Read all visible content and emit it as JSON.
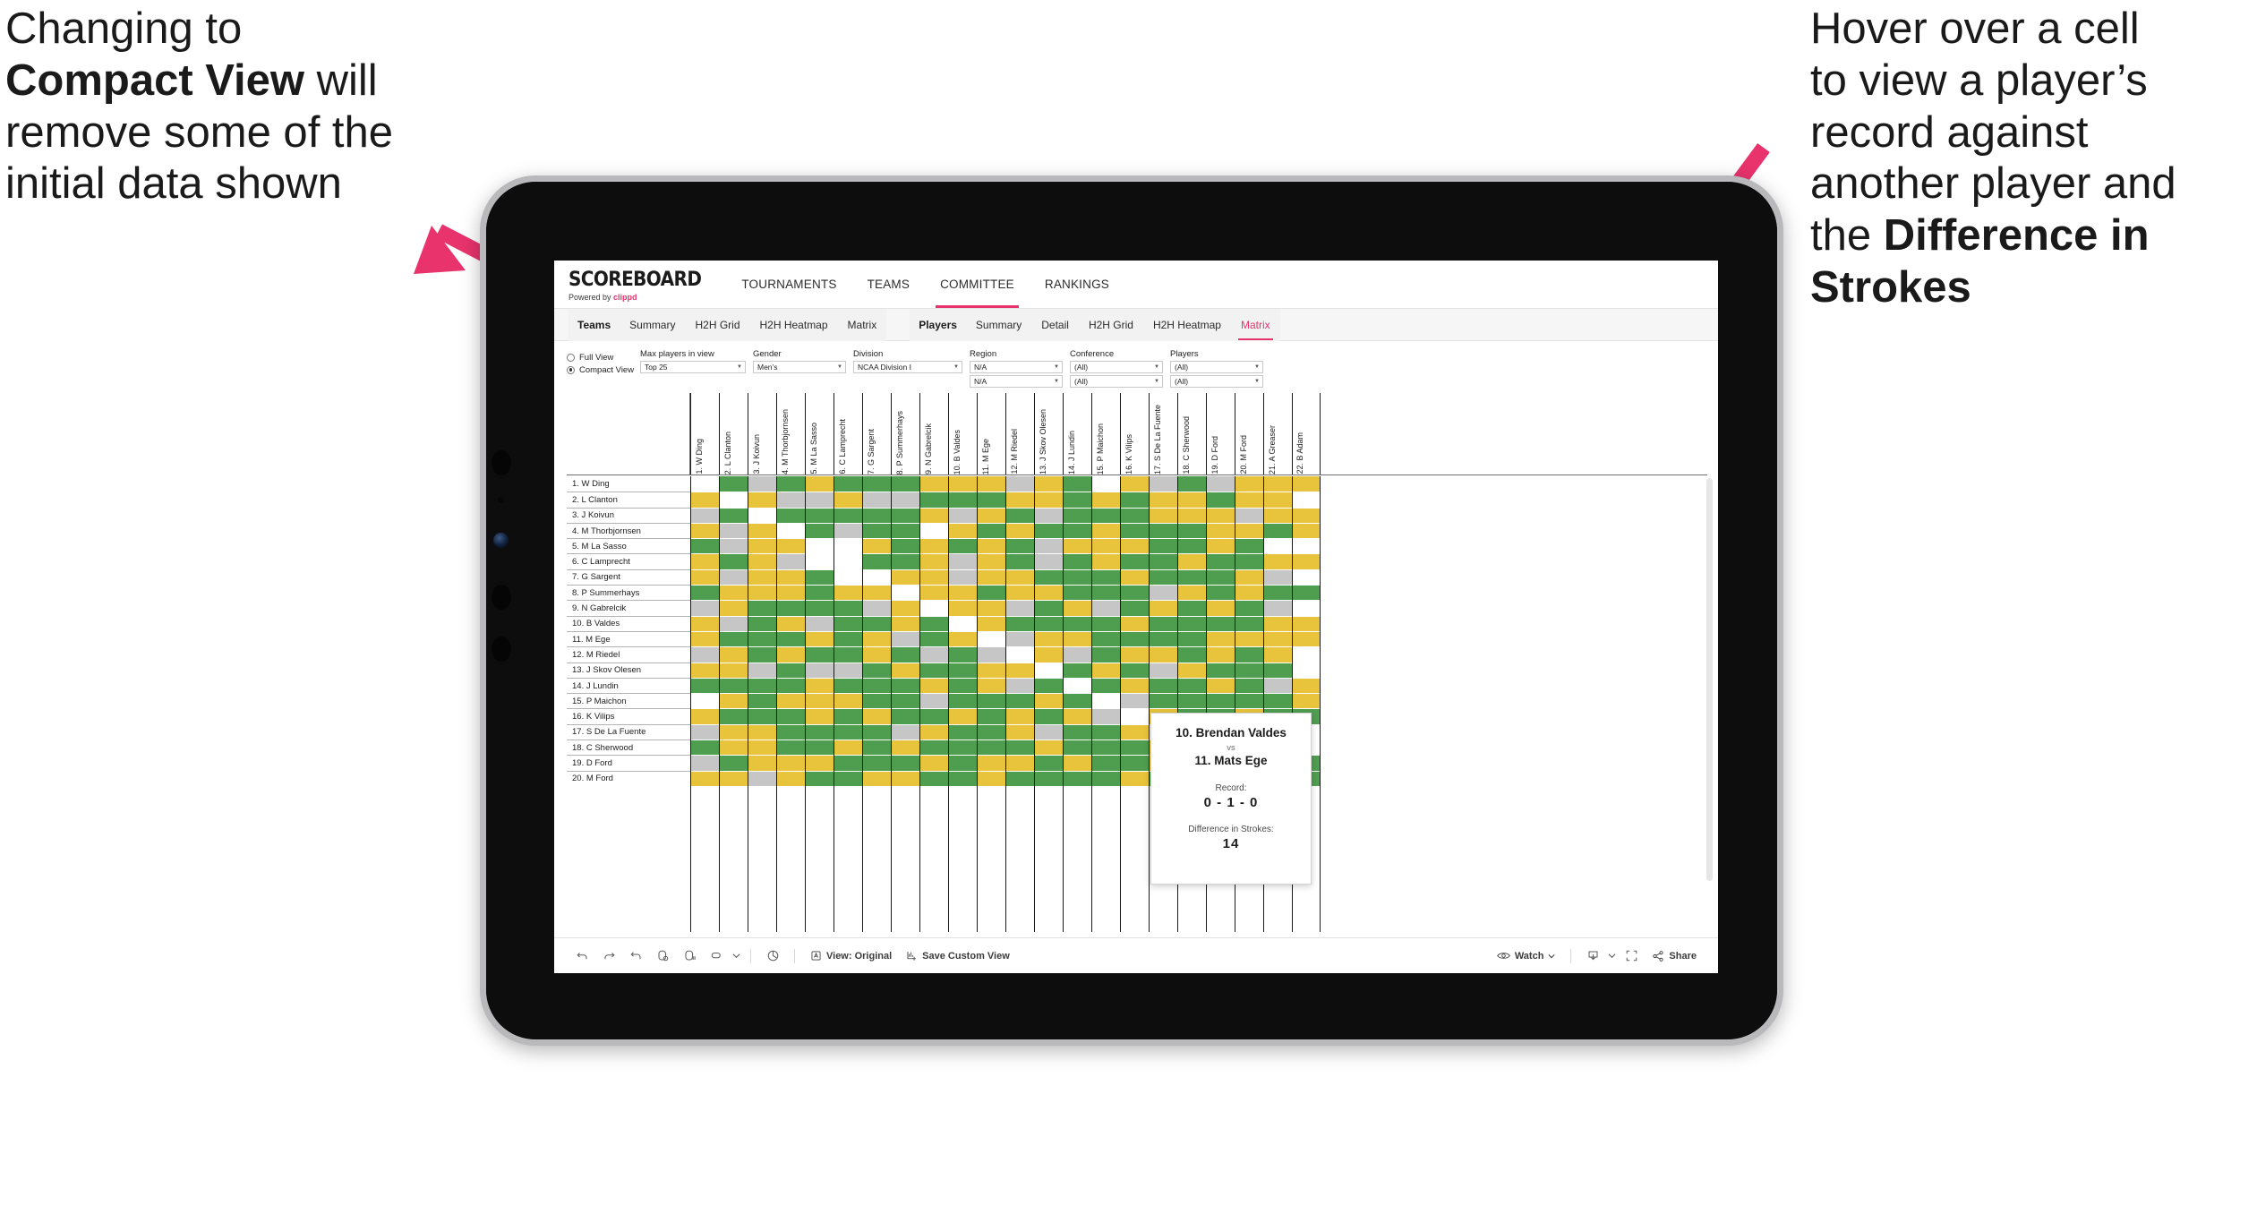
{
  "annotations": {
    "left": {
      "line1": "Changing to",
      "bold": "Compact View",
      "line2": " will",
      "line3": "remove some of the",
      "line4": "initial data shown"
    },
    "right": {
      "line1": "Hover over a cell",
      "line2": "to view a player’s",
      "line3": "record against",
      "line4": "another player and",
      "line5": "the ",
      "bold": "Difference in",
      "bold2": "Strokes"
    },
    "arrow_color": "#e8336d"
  },
  "brand": {
    "title": "SCOREBOARD",
    "powered_prefix": "Powered by ",
    "powered_name": "clippd",
    "accent": "#e8336d"
  },
  "topnav": {
    "items": [
      {
        "label": "TOURNAMENTS",
        "active": false
      },
      {
        "label": "TEAMS",
        "active": false
      },
      {
        "label": "COMMITTEE",
        "active": true
      },
      {
        "label": "RANKINGS",
        "active": false
      }
    ]
  },
  "subnav": {
    "group1": {
      "head": "Teams",
      "items": [
        "Summary",
        "H2H Grid",
        "H2H Heatmap",
        "Matrix"
      ],
      "active": null
    },
    "group2": {
      "head": "Players",
      "items": [
        "Summary",
        "Detail",
        "H2H Grid",
        "H2H Heatmap",
        "Matrix"
      ],
      "active": "Matrix"
    }
  },
  "filters": {
    "view_mode": {
      "full_label": "Full View",
      "compact_label": "Compact View",
      "selected": "Compact View"
    },
    "controls": [
      {
        "label": "Max players in view",
        "value": "Top 25",
        "second": null
      },
      {
        "label": "Gender",
        "value": "Men’s",
        "second": null
      },
      {
        "label": "Division",
        "value": "NCAA Division I",
        "second": null
      },
      {
        "label": "Region",
        "value": "N/A",
        "second": "N/A"
      },
      {
        "label": "Conference",
        "value": "(All)",
        "second": "(All)"
      },
      {
        "label": "Players",
        "value": "(All)",
        "second": "(All)"
      }
    ]
  },
  "matrix": {
    "columns": [
      "1. W Ding",
      "2. L Clanton",
      "3. J Koivun",
      "4. M Thorbjornsen",
      "5. M La Sasso",
      "6. C Lamprecht",
      "7. G Sargent",
      "8. P Summerhays",
      "9. N Gabrelcik",
      "10. B Valdes",
      "11. M Ege",
      "12. M Riedel",
      "13. J Skov Olesen",
      "14. J Lundin",
      "15. P Maichon",
      "16. K Vilips",
      "17. S De La Fuente",
      "18. C Sherwood",
      "19. D Ford",
      "20. M Ford",
      "21. A Greaser",
      "22. B Adam"
    ],
    "rows": [
      "1. W Ding",
      "2. L Clanton",
      "3. J Koivun",
      "4. M Thorbjornsen",
      "5. M La Sasso",
      "6. C Lamprecht",
      "7. G Sargent",
      "8. P Summerhays",
      "9. N Gabrelcik",
      "10. B Valdes",
      "11. M Ege",
      "12. M Riedel",
      "13. J Skov Olesen",
      "14. J Lundin",
      "15. P Maichon",
      "16. K Vilips",
      "17. S De La Fuente",
      "18. C Sherwood",
      "19. D Ford",
      "20. M Ford"
    ],
    "legend": {
      "win": "#4f9e4f",
      "tie": "#e8c33c",
      "loss": "#c6c6c6",
      "none": "#ffffff"
    },
    "cells": [
      [
        "w",
        "y",
        "a",
        "y",
        "g",
        "y",
        "y",
        "g",
        "a",
        "y",
        "y",
        "a",
        "y",
        "g",
        "w",
        "y",
        "a",
        "g",
        "a",
        "y"
      ],
      [
        "g",
        "w",
        "g",
        "a",
        "a",
        "g",
        "a",
        "y",
        "y",
        "a",
        "g",
        "y",
        "y",
        "g",
        "y",
        "g",
        "y",
        "y",
        "g",
        "y"
      ],
      [
        "a",
        "y",
        "w",
        "y",
        "y",
        "y",
        "y",
        "y",
        "g",
        "g",
        "g",
        "g",
        "a",
        "g",
        "g",
        "g",
        "y",
        "y",
        "y",
        "a"
      ],
      [
        "g",
        "a",
        "g",
        "w",
        "y",
        "a",
        "y",
        "y",
        "g",
        "y",
        "g",
        "y",
        "g",
        "g",
        "y",
        "g",
        "g",
        "g",
        "y",
        "y"
      ],
      [
        "y",
        "a",
        "g",
        "g",
        "w",
        "w",
        "g",
        "g",
        "g",
        "a",
        "y",
        "g",
        "a",
        "y",
        "y",
        "y",
        "g",
        "g",
        "y",
        "g"
      ],
      [
        "g",
        "y",
        "g",
        "a",
        "w",
        "w",
        "w",
        "y",
        "g",
        "g",
        "g",
        "g",
        "a",
        "g",
        "y",
        "g",
        "g",
        "y",
        "g",
        "g"
      ],
      [
        "g",
        "a",
        "g",
        "g",
        "y",
        "g",
        "w",
        "y",
        "a",
        "g",
        "y",
        "y",
        "g",
        "g",
        "g",
        "y",
        "g",
        "g",
        "g",
        "y"
      ],
      [
        "g",
        "a",
        "g",
        "g",
        "g",
        "g",
        "y",
        "w",
        "y",
        "y",
        "a",
        "g",
        "y",
        "g",
        "g",
        "g",
        "a",
        "y",
        "g",
        "y"
      ],
      [
        "y",
        "g",
        "y",
        "w",
        "y",
        "y",
        "y",
        "y",
        "w",
        "g",
        "g",
        "a",
        "g",
        "y",
        "a",
        "g",
        "y",
        "g",
        "y",
        "g"
      ],
      [
        "y",
        "g",
        "a",
        "y",
        "g",
        "a",
        "a",
        "y",
        "y",
        "w",
        "y",
        "g",
        "g",
        "g",
        "g",
        "y",
        "g",
        "g",
        "g",
        "g"
      ],
      [
        "y",
        "g",
        "y",
        "g",
        "y",
        "y",
        "y",
        "g",
        "y",
        "y",
        "w",
        "a",
        "y",
        "y",
        "g",
        "g",
        "g",
        "g",
        "y",
        "y"
      ],
      [
        "a",
        "y",
        "g",
        "y",
        "g",
        "g",
        "y",
        "y",
        "a",
        "g",
        "a",
        "w",
        "y",
        "a",
        "g",
        "y",
        "y",
        "g",
        "y",
        "g"
      ],
      [
        "y",
        "y",
        "a",
        "g",
        "a",
        "a",
        "g",
        "y",
        "g",
        "g",
        "y",
        "y",
        "w",
        "g",
        "y",
        "g",
        "a",
        "y",
        "g",
        "g"
      ],
      [
        "g",
        "g",
        "g",
        "g",
        "y",
        "g",
        "g",
        "g",
        "y",
        "g",
        "y",
        "a",
        "g",
        "w",
        "g",
        "y",
        "g",
        "g",
        "y",
        "g"
      ],
      [
        "w",
        "y",
        "g",
        "y",
        "y",
        "y",
        "g",
        "g",
        "a",
        "g",
        "g",
        "g",
        "y",
        "g",
        "w",
        "a",
        "g",
        "g",
        "g",
        "g"
      ],
      [
        "y",
        "g",
        "g",
        "g",
        "y",
        "g",
        "y",
        "g",
        "g",
        "y",
        "g",
        "y",
        "g",
        "y",
        "a",
        "w",
        "y",
        "g",
        "g",
        "y"
      ],
      [
        "a",
        "y",
        "y",
        "g",
        "g",
        "g",
        "g",
        "a",
        "y",
        "g",
        "g",
        "y",
        "a",
        "g",
        "g",
        "y",
        "w",
        "y",
        "y",
        "g"
      ],
      [
        "g",
        "y",
        "y",
        "g",
        "g",
        "y",
        "g",
        "y",
        "g",
        "g",
        "g",
        "g",
        "y",
        "g",
        "g",
        "g",
        "y",
        "w",
        "g",
        "g"
      ],
      [
        "a",
        "g",
        "y",
        "y",
        "y",
        "g",
        "g",
        "g",
        "y",
        "g",
        "y",
        "y",
        "g",
        "y",
        "g",
        "g",
        "y",
        "g",
        "w",
        "y"
      ],
      [
        "y",
        "y",
        "a",
        "y",
        "g",
        "g",
        "y",
        "y",
        "g",
        "g",
        "y",
        "g",
        "g",
        "g",
        "g",
        "y",
        "g",
        "g",
        "y",
        "w"
      ],
      [
        "y",
        "y",
        "y",
        "g",
        "w",
        "y",
        "a",
        "g",
        "a",
        "y",
        "y",
        "y",
        "g",
        "a",
        "g",
        "g",
        "y",
        "g",
        "y",
        "g"
      ],
      [
        "y",
        "w",
        "y",
        "y",
        "w",
        "y",
        "w",
        "g",
        "w",
        "y",
        "y",
        "w",
        "w",
        "y",
        "y",
        "g",
        "w",
        "w",
        "g",
        "g"
      ]
    ]
  },
  "tooltip": {
    "player_a": "10. Brendan Valdes",
    "vs": "vs",
    "player_b": "11. Mats Ege",
    "record_label": "Record:",
    "record_value": "0 - 1 - 0",
    "strokes_label": "Difference in Strokes:",
    "strokes_value": "14"
  },
  "toolbar": {
    "icons": [
      "undo-icon",
      "redo-icon",
      "revert-icon",
      "refresh-icon",
      "pause-icon",
      "filter-icon",
      "chevron-down-icon",
      "help-icon"
    ],
    "view_label": "View: Original",
    "save_label": "Save Custom View",
    "watch_label": "Watch",
    "share_label": "Share"
  }
}
